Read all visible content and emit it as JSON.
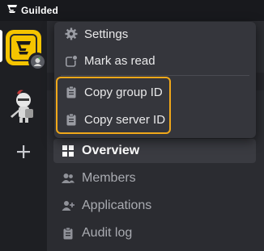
{
  "app": {
    "brand_name": "Guilded"
  },
  "colors": {
    "brand_yellow": "#f5c400",
    "highlight_orange": "#f0a81a",
    "menu_bg": "#35363c",
    "rail_bg": "#1e1f23"
  },
  "rail": {
    "servers": [
      {
        "icon": "guilded-server-icon",
        "active": true
      },
      {
        "icon": "knight-avatar-icon",
        "active": false
      }
    ],
    "add_icon": "plus-icon"
  },
  "context_menu": {
    "items": [
      {
        "label": "Settings",
        "icon": "gear-icon"
      },
      {
        "label": "Mark as read",
        "icon": "mark-read-icon"
      },
      {
        "label": "Copy group ID",
        "icon": "clipboard-icon"
      },
      {
        "label": "Copy server ID",
        "icon": "clipboard-icon"
      }
    ]
  },
  "nav": {
    "items": [
      {
        "label": "Overview",
        "icon": "grid-icon",
        "selected": true
      },
      {
        "label": "Members",
        "icon": "members-icon",
        "selected": false
      },
      {
        "label": "Applications",
        "icon": "person-add-icon",
        "selected": false
      },
      {
        "label": "Audit log",
        "icon": "clipboard-icon",
        "selected": false
      }
    ]
  }
}
